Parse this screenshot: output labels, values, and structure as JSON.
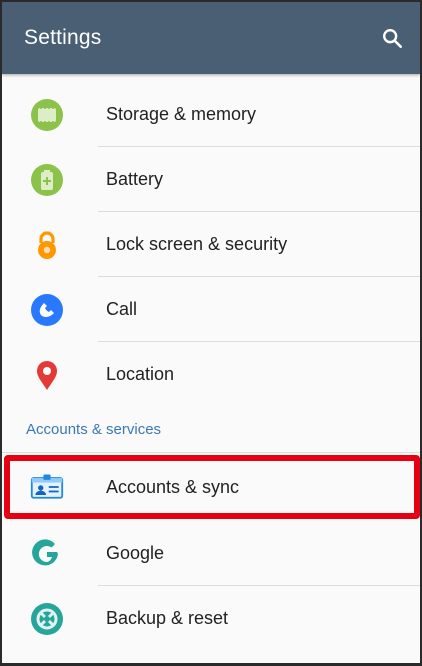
{
  "appbar": {
    "title": "Settings",
    "search_icon": "search-icon",
    "color": "#4a5f73"
  },
  "items_top": [
    {
      "label": "Storage & memory",
      "icon": "storage-icon",
      "color": "#8bc34a"
    },
    {
      "label": "Battery",
      "icon": "battery-icon",
      "color": "#8bc34a"
    },
    {
      "label": "Lock screen & security",
      "icon": "lock-icon",
      "color": "#ff9800"
    },
    {
      "label": "Call",
      "icon": "phone-icon",
      "color": "#2979ff"
    },
    {
      "label": "Location",
      "icon": "location-pin-icon",
      "color": "#e53935"
    }
  ],
  "section": {
    "header": "Accounts & services",
    "color": "#3a78b5"
  },
  "items_bottom": [
    {
      "label": "Accounts & sync",
      "icon": "account-card-icon",
      "highlighted": true
    },
    {
      "label": "Google",
      "icon": "google-g-icon",
      "color": "#26a69a"
    },
    {
      "label": "Backup & reset",
      "icon": "backup-restore-icon",
      "color": "#26a69a"
    }
  ],
  "highlight_color": "#e60012"
}
